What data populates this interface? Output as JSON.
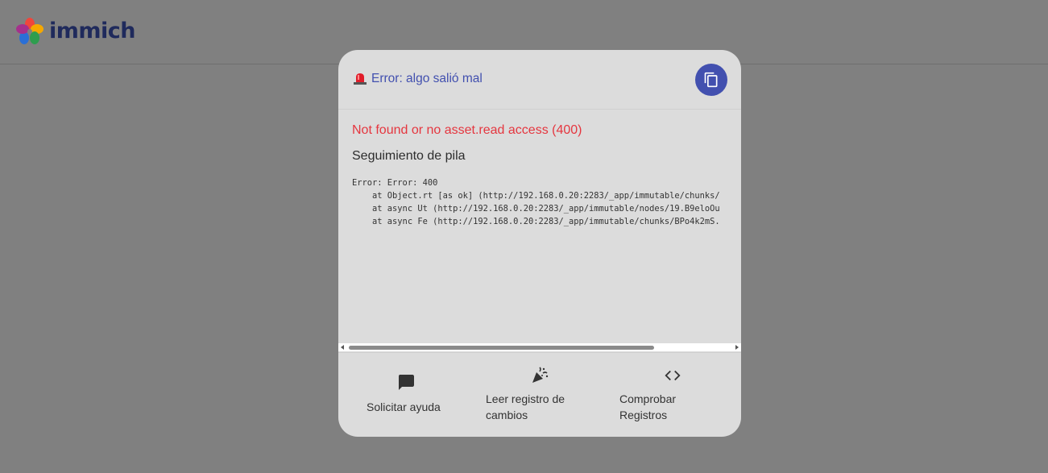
{
  "app": {
    "logo_text": "immich"
  },
  "dialog": {
    "title": "Error: algo salió mal",
    "error_message": "Not found or no asset.read access (400)",
    "stack_title": "Seguimiento de pila",
    "stack_lines": [
      "Error: Error: 400",
      "    at Object.rt [as ok] (http://192.168.0.20:2283/_app/immutable/chunks/",
      "    at async Ut (http://192.168.0.20:2283/_app/immutable/nodes/19.B9eloOu",
      "    at async Fe (http://192.168.0.20:2283/_app/immutable/chunks/BPo4k2mS."
    ],
    "copy_icon": "copy-icon",
    "accent_color": "#4250af",
    "error_color": "#e5363f"
  },
  "actions": [
    {
      "label": "Solicitar ayuda",
      "icon": "chat-icon"
    },
    {
      "label_line1": "Leer registro de",
      "label_line2": "cambios",
      "icon": "party-popper-icon"
    },
    {
      "label_line1": "Comprobar",
      "label_line2": "Registros",
      "icon": "code-icon"
    }
  ]
}
